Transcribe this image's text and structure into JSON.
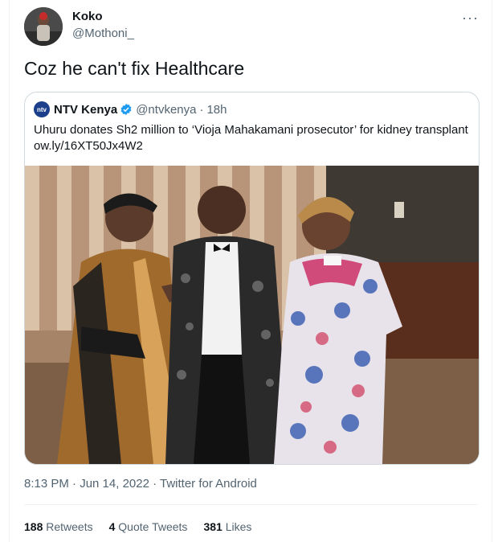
{
  "user": {
    "name": "Koko",
    "handle": "@Mothoni_"
  },
  "more_label": "···",
  "tweet": {
    "text": "Coz he can't fix Healthcare"
  },
  "quoted": {
    "logo_text": "ntv",
    "name": "NTV Kenya",
    "handle": "@ntvkenya",
    "separator": "·",
    "time": "18h",
    "text": "Uhuru donates Sh2 million to ‘Vioja Mahakamani prosecutor’ for kidney transplant ow.ly/16XT50Jx4W2"
  },
  "timestamp": "8:13 PM · Jun 14, 2022 · Twitter for Android",
  "stats": {
    "retweets": {
      "count": "188",
      "label": "Retweets"
    },
    "quotes": {
      "count": "4",
      "label": "Quote Tweets"
    },
    "likes": {
      "count": "381",
      "label": "Likes"
    }
  },
  "colors": {
    "accent": "#1d9bf0",
    "muted": "#536471",
    "border": "#cfd9de"
  }
}
